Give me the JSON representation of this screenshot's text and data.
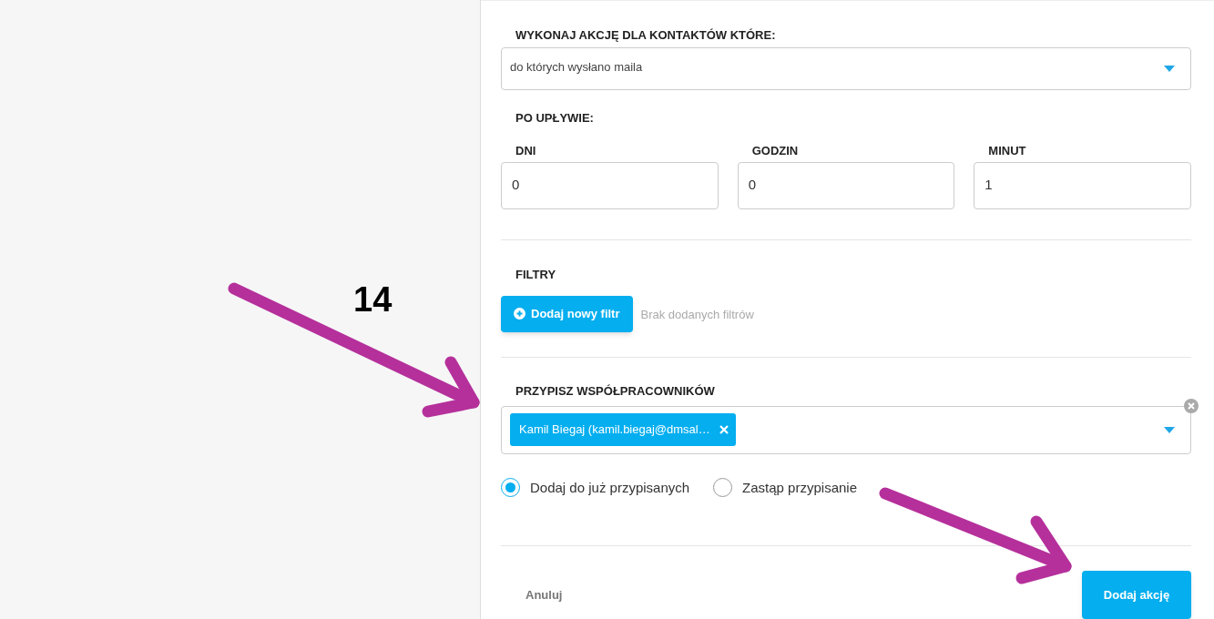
{
  "annotation": {
    "label": "14"
  },
  "condition": {
    "label": "WYKONAJ AKCJĘ DLA KONTAKTÓW KTÓRE:",
    "value": "do których wysłano maila"
  },
  "delay": {
    "label": "PO UPŁYWIE:",
    "fields": [
      {
        "label": "DNI",
        "value": "0"
      },
      {
        "label": "GODZIN",
        "value": "0"
      },
      {
        "label": "MINUT",
        "value": "1"
      }
    ]
  },
  "filters": {
    "label": "FILTRY",
    "button": "Dodaj nowy filtr",
    "empty_text": "Brak dodanych filtrów"
  },
  "assign": {
    "label": "PRZYPISZ WSPÓŁPRACOWNIKÓW",
    "tags": [
      "Kamil Biegaj (kamil.biegaj@dmsal…"
    ],
    "options": [
      {
        "label": "Dodaj do już przypisanych",
        "selected": true
      },
      {
        "label": "Zastąp przypisanie",
        "selected": false
      }
    ]
  },
  "footer": {
    "cancel": "Anuluj",
    "submit": "Dodaj akcję"
  }
}
